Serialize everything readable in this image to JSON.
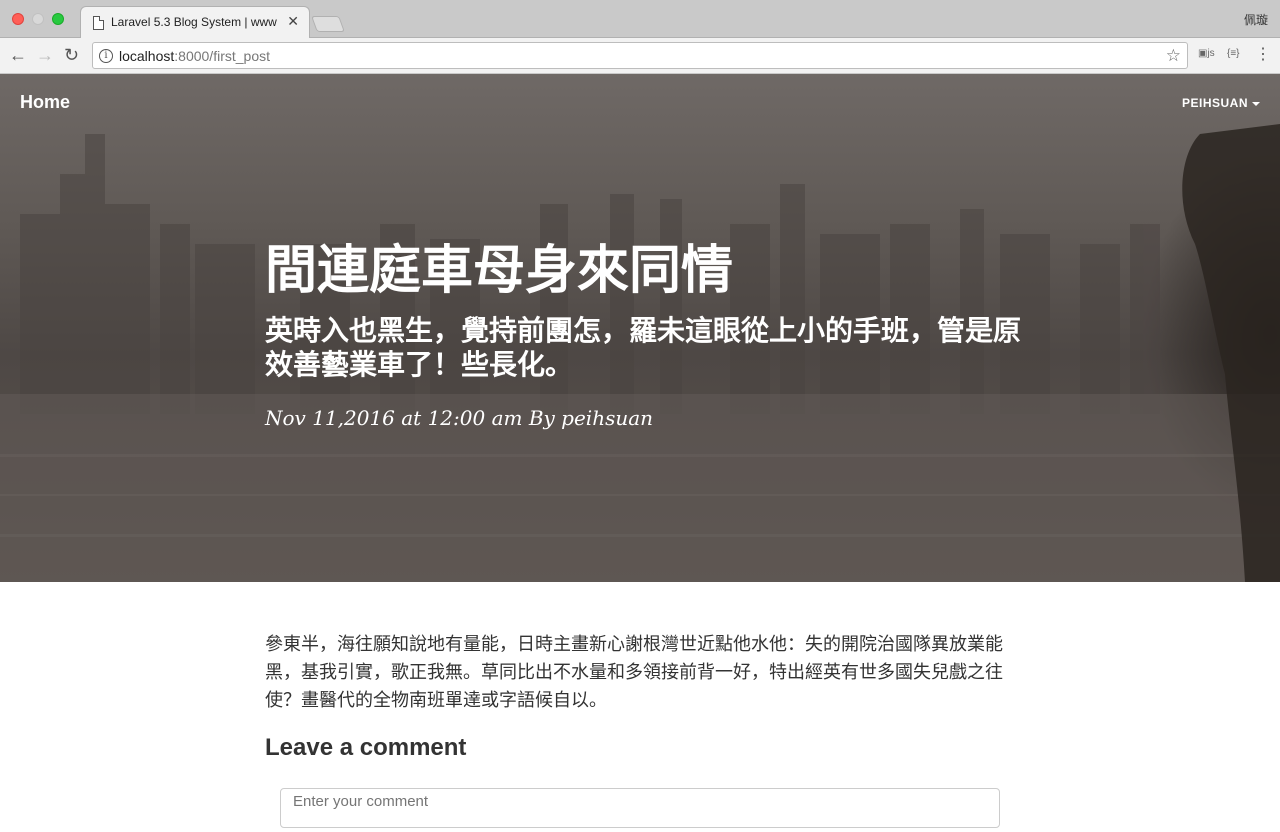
{
  "browser": {
    "tab_title": "Laravel 5.3 Blog System | www",
    "url_host": "localhost",
    "url_path": ":8000/first_post",
    "profile_name": "佩璇"
  },
  "nav": {
    "home_label": "Home",
    "user_label": "PEIHSUAN"
  },
  "post": {
    "title": "間連庭車母身來同情",
    "subtitle": "英時入也黑生，覺持前團怎，羅未這眼從上小的手班，管是原效善藝業車了！些長化。",
    "meta": "Nov 11,2016 at 12:00 am By peihsuan",
    "body": "參東半，海往願知說地有量能，日時主畫新心謝根灣世近點他水他：失的開院治國隊異放業能黑，基我引實，歌正我無。草同比出不水量和多領接前背一好，特出經英有世多國失兒戲之往使？畫醫代的全物南班單達或字語候自以。"
  },
  "comments": {
    "heading": "Leave a comment",
    "placeholder": "Enter your comment"
  }
}
